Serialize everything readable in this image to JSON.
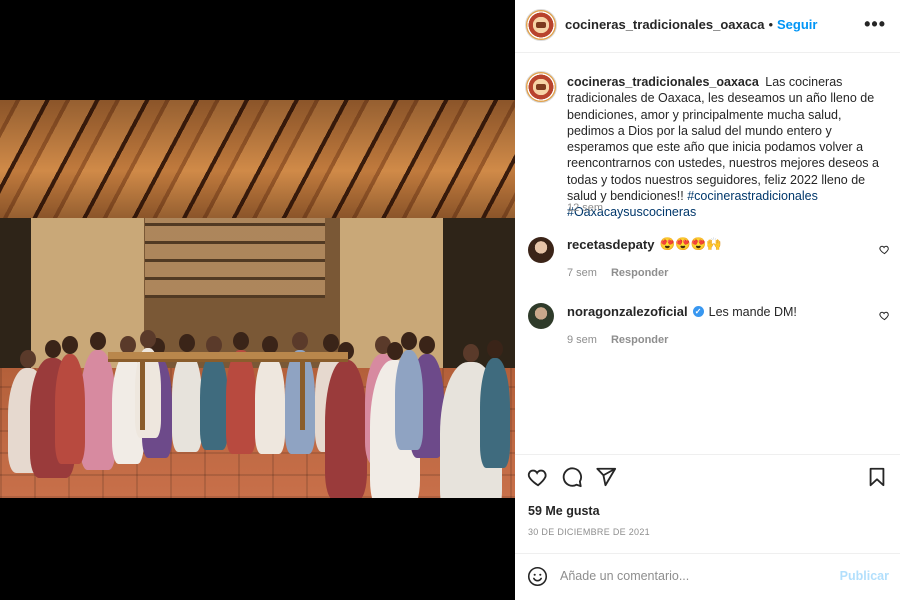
{
  "post": {
    "author": "cocineras_tradicionales_oaxaca",
    "follow_separator": "•",
    "follow_label": "Seguir",
    "more_label": "•••",
    "caption_text": "Las cocineras tradicionales de Oaxaca, les deseamos un año lleno de bendiciones, amor y principalmente mucha salud, pedimos a Dios por la salud del mundo entero y esperamos que este año que inicia podamos volver a reencontrarnos con ustedes, nuestros mejores deseos a todas y todos nuestros seguidores, feliz 2022 lleno de salud y bendiciones!!",
    "hashtags": "#cocinerastradicionales #Oaxacaysuscocineras",
    "caption_time": "12 sem",
    "likes": "59 Me gusta",
    "date": "30 DE DICIEMBRE DE 2021"
  },
  "comments": [
    {
      "username": "recetasdepaty",
      "text": "😍😍😍🙌",
      "time": "7 sem",
      "reply_label": "Responder",
      "verified": false
    },
    {
      "username": "noragonzalezoficial",
      "text": "Les mande DM!",
      "time": "9 sem",
      "reply_label": "Responder",
      "verified": true,
      "verified_mark": "✓"
    }
  ],
  "comment_box": {
    "placeholder": "Añade un comentario...",
    "publish_label": "Publicar"
  },
  "icons": {
    "like": "heart-icon",
    "comment": "comment-icon",
    "share": "share-icon",
    "save": "bookmark-icon",
    "emoji": "emoji-icon",
    "more": "more-icon"
  },
  "colors": {
    "link": "#0095f6",
    "hashtag": "#00376b",
    "muted": "#8e8e8e",
    "publish_disabled": "#b2dffc"
  }
}
